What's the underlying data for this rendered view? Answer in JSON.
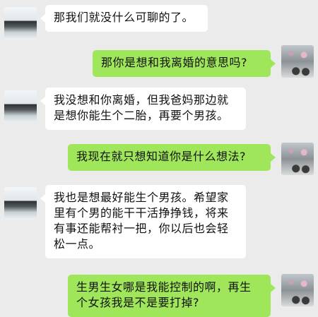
{
  "messages": [
    {
      "side": "left",
      "text": "那我们就没什么可聊的了。"
    },
    {
      "side": "right",
      "text": "那你是想和我离婚的意思吗?"
    },
    {
      "side": "left",
      "text": "我没想和你离婚，但我爸妈那边就是想你能生个二胎，再要个男孩。"
    },
    {
      "side": "right",
      "text": "我现在就只想知道你是什么想法?"
    },
    {
      "side": "left",
      "text": "我也是想最好能生个男孩。希望家里有个男的能干干活挣挣钱，将来有事还能帮衬一把，你以后也会轻松一点。"
    },
    {
      "side": "right",
      "text": "生男生女哪是我能控制的啊，再生个女孩我是不是要打掉?"
    }
  ]
}
